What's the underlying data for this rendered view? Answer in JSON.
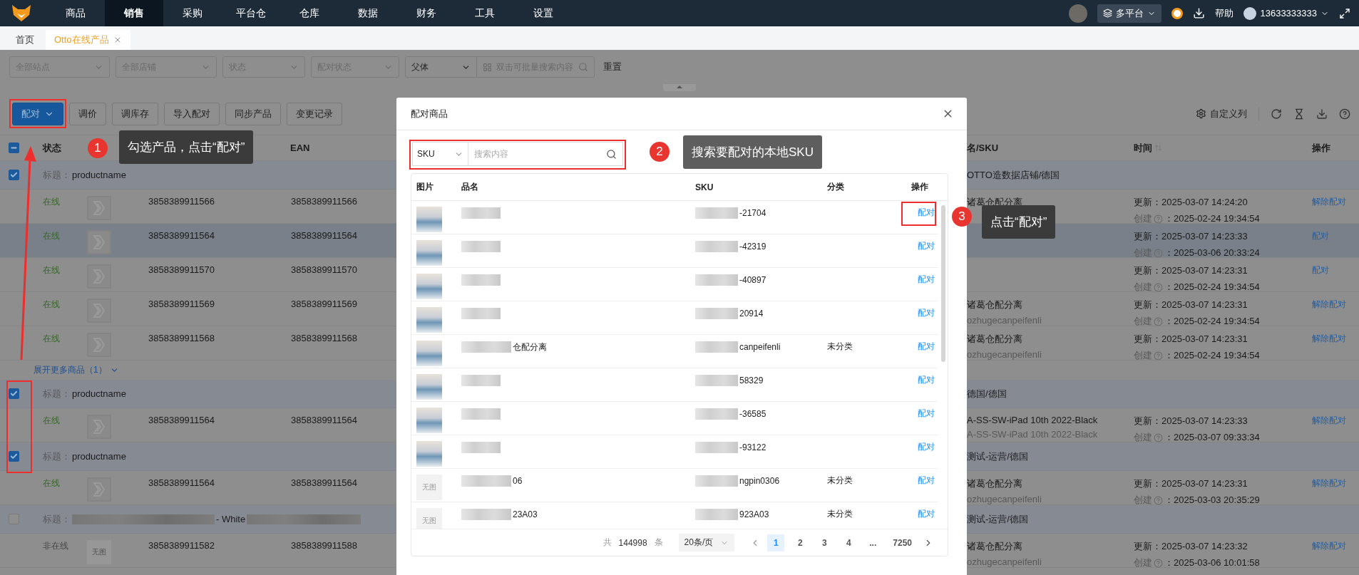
{
  "nav": {
    "items": [
      {
        "label": "商品",
        "selected": false
      },
      {
        "label": "销售",
        "selected": true
      },
      {
        "label": "采购",
        "selected": false
      },
      {
        "label": "平台仓",
        "selected": false
      },
      {
        "label": "仓库",
        "selected": false
      },
      {
        "label": "数据",
        "selected": false
      },
      {
        "label": "财务",
        "selected": false
      },
      {
        "label": "工具",
        "selected": false
      },
      {
        "label": "设置",
        "selected": false
      }
    ],
    "platform": "多平台",
    "help": "帮助",
    "user": "13633333333"
  },
  "tabs": [
    {
      "label": "首页",
      "selected": false,
      "closable": false
    },
    {
      "label": "Otto在线产品",
      "selected": true,
      "closable": true
    }
  ],
  "filters": {
    "selects": [
      {
        "placeholder": "全部站点"
      },
      {
        "placeholder": "全部店铺"
      },
      {
        "placeholder": "状态"
      },
      {
        "placeholder": "配对状态"
      }
    ],
    "search_type": "父体",
    "search": {
      "placeholder": "双击可批量搜索内容"
    },
    "reset": "重置"
  },
  "toolbar": {
    "buttons": [
      {
        "label": "配对",
        "kind": "primary"
      },
      {
        "label": "调价",
        "kind": "default"
      },
      {
        "label": "调库存",
        "kind": "default"
      },
      {
        "label": "导入配对",
        "kind": "default"
      },
      {
        "label": "同步产品",
        "kind": "default"
      },
      {
        "label": "变更记录",
        "kind": "default"
      }
    ],
    "customize": "自定义列"
  },
  "table": {
    "header_checkbox": {
      "indeterminate": true
    },
    "columns": {
      "status": "状态",
      "ean": "EAN",
      "name_sku": "名/SKU",
      "time": "时间",
      "action": "操作"
    },
    "groups": [
      {
        "checked": true,
        "title_label": "标题：",
        "title": "productname",
        "redacted": false,
        "shop": "OTTO造数据店铺/德国",
        "more": "展开更多商品（1）",
        "products": [
          {
            "status": "在线",
            "online": true,
            "image": {
              "kind": "logo"
            },
            "sku": "3858389911566",
            "ean": "3858389911566",
            "highlighted": false,
            "name": "诸葛仓配分离",
            "updated": "更新：2025-03-07 14:24:20",
            "created_label": "创建",
            "created": "：2025-02-24 19:34:54",
            "action": "解除配对"
          },
          {
            "status": "在线",
            "online": true,
            "image": {
              "kind": "logo"
            },
            "sku": "3858389911564",
            "ean": "3858389911564",
            "highlighted": true,
            "updated": "更新：2025-03-07 14:23:33",
            "created_label": "创建",
            "created": "：2025-03-06 20:33:24",
            "action": "配对"
          },
          {
            "status": "在线",
            "online": true,
            "image": {
              "kind": "logo"
            },
            "sku": "3858389911570",
            "ean": "3858389911570",
            "highlighted": false,
            "updated": "更新：2025-03-07 14:23:31",
            "created_label": "创建",
            "created": "：2025-02-24 19:34:54",
            "action": "配对"
          },
          {
            "status": "在线",
            "online": true,
            "image": {
              "kind": "logo"
            },
            "sku": "3858389911569",
            "ean": "3858389911569",
            "highlighted": false,
            "name": "诸葛仓配分离",
            "code": "ozhugecanpeifenli",
            "updated": "更新：2025-03-07 14:23:31",
            "created_label": "创建",
            "created": "：2025-02-24 19:34:54",
            "action": "解除配对"
          },
          {
            "status": "在线",
            "online": true,
            "image": {
              "kind": "logo"
            },
            "sku": "3858389911568",
            "ean": "3858389911568",
            "highlighted": false,
            "name": "诸葛仓配分离",
            "code": "ozhugecanpeifenli",
            "updated": "更新：2025-03-07 14:23:31",
            "created_label": "创建",
            "created": "：2025-02-24 19:34:54",
            "action": "解除配对"
          }
        ]
      },
      {
        "checked": true,
        "title_label": "标题：",
        "title": "productname",
        "redacted": false,
        "shop": "德国/德国",
        "products": [
          {
            "status": "在线",
            "online": true,
            "image": {
              "kind": "logo"
            },
            "sku": "3858389911564",
            "ean": "3858389911564",
            "highlighted": false,
            "name": "A-SS-SW-iPad 10th 2022-Black",
            "code": "A-SS-SW-iPad 10th 2022-Black",
            "updated": "更新：2025-03-07 14:23:33",
            "created_label": "创建",
            "created": "：2025-03-07 09:33:34",
            "action": "解除配对"
          }
        ]
      },
      {
        "checked": true,
        "title_label": "标题：",
        "title": "productname",
        "redacted": false,
        "shop": "测试-运营/德国",
        "products": [
          {
            "status": "在线",
            "online": true,
            "image": {
              "kind": "logo"
            },
            "sku": "3858389911564",
            "ean": "3858389911564",
            "highlighted": false,
            "name": "诸葛仓配分离",
            "code": "ozhugecanpeifenli",
            "updated": "更新：2025-03-07 14:23:31",
            "created_label": "创建",
            "created": "：2025-03-03 20:35:29",
            "action": "解除配对"
          }
        ]
      },
      {
        "checked": false,
        "title_label": "标题：",
        "title": "- White",
        "redacted": true,
        "shop": "测试-运营/德国",
        "products": [
          {
            "status": "非在线",
            "online": false,
            "image": {
              "kind": "none",
              "text": "无图"
            },
            "sku": "3858389911582",
            "ean": "3858389911588",
            "highlighted": false,
            "name": "诸葛仓配分离",
            "code": "ozhugecanpeifenli",
            "updated": "更新：2025-03-07 14:23:32",
            "created_label": "创建",
            "created": "：2025-03-06 10:01:58",
            "action": "解除配对"
          }
        ]
      }
    ]
  },
  "modal": {
    "title": "配对商品",
    "search_type": "SKU",
    "search": {
      "placeholder": "搜索内容"
    },
    "columns": {
      "image": "图片",
      "name": "品名",
      "sku": "SKU",
      "category": "分类",
      "action": "操作"
    },
    "rows": [
      {
        "image": {
          "kind": "photo"
        },
        "sku": "-21704",
        "action": "配对"
      },
      {
        "image": {
          "kind": "photo"
        },
        "sku": "-42319",
        "action": "配对"
      },
      {
        "image": {
          "kind": "photo"
        },
        "sku": "-40897",
        "action": "配对"
      },
      {
        "image": {
          "kind": "photo"
        },
        "sku": "20914",
        "action": "配对"
      },
      {
        "image": {
          "kind": "photo"
        },
        "name": "仓配分离",
        "sku": "canpeifenli",
        "category": "未分类",
        "action": "配对"
      },
      {
        "image": {
          "kind": "photo"
        },
        "sku": "58329",
        "action": "配对"
      },
      {
        "image": {
          "kind": "photo"
        },
        "sku": "-36585",
        "action": "配对"
      },
      {
        "image": {
          "kind": "photo"
        },
        "sku": "-93122",
        "action": "配对"
      },
      {
        "image": {
          "kind": "none",
          "text": "无图"
        },
        "name": "06",
        "sku": "ngpin0306",
        "category": "未分类",
        "action": "配对"
      },
      {
        "image": {
          "kind": "none",
          "text": "无图"
        },
        "name": "23A03",
        "sku": "923A03",
        "category": "未分类",
        "action": "配对"
      }
    ],
    "pagination": {
      "total_prefix": "共",
      "total": "144998",
      "total_suffix": "条",
      "page_size": "20条/页",
      "pages": [
        {
          "label": "1",
          "selected": true
        },
        {
          "label": "2",
          "selected": false
        },
        {
          "label": "3",
          "selected": false
        },
        {
          "label": "4",
          "selected": false
        },
        {
          "label": "...",
          "selected": false
        },
        {
          "label": "7250",
          "selected": false
        }
      ]
    }
  },
  "annotations": [
    {
      "number": "1",
      "text": "勾选产品，点击“配对”"
    },
    {
      "number": "2",
      "text": "搜索要配对的本地SKU"
    },
    {
      "number": "3",
      "text": "点击“配对”"
    }
  ]
}
